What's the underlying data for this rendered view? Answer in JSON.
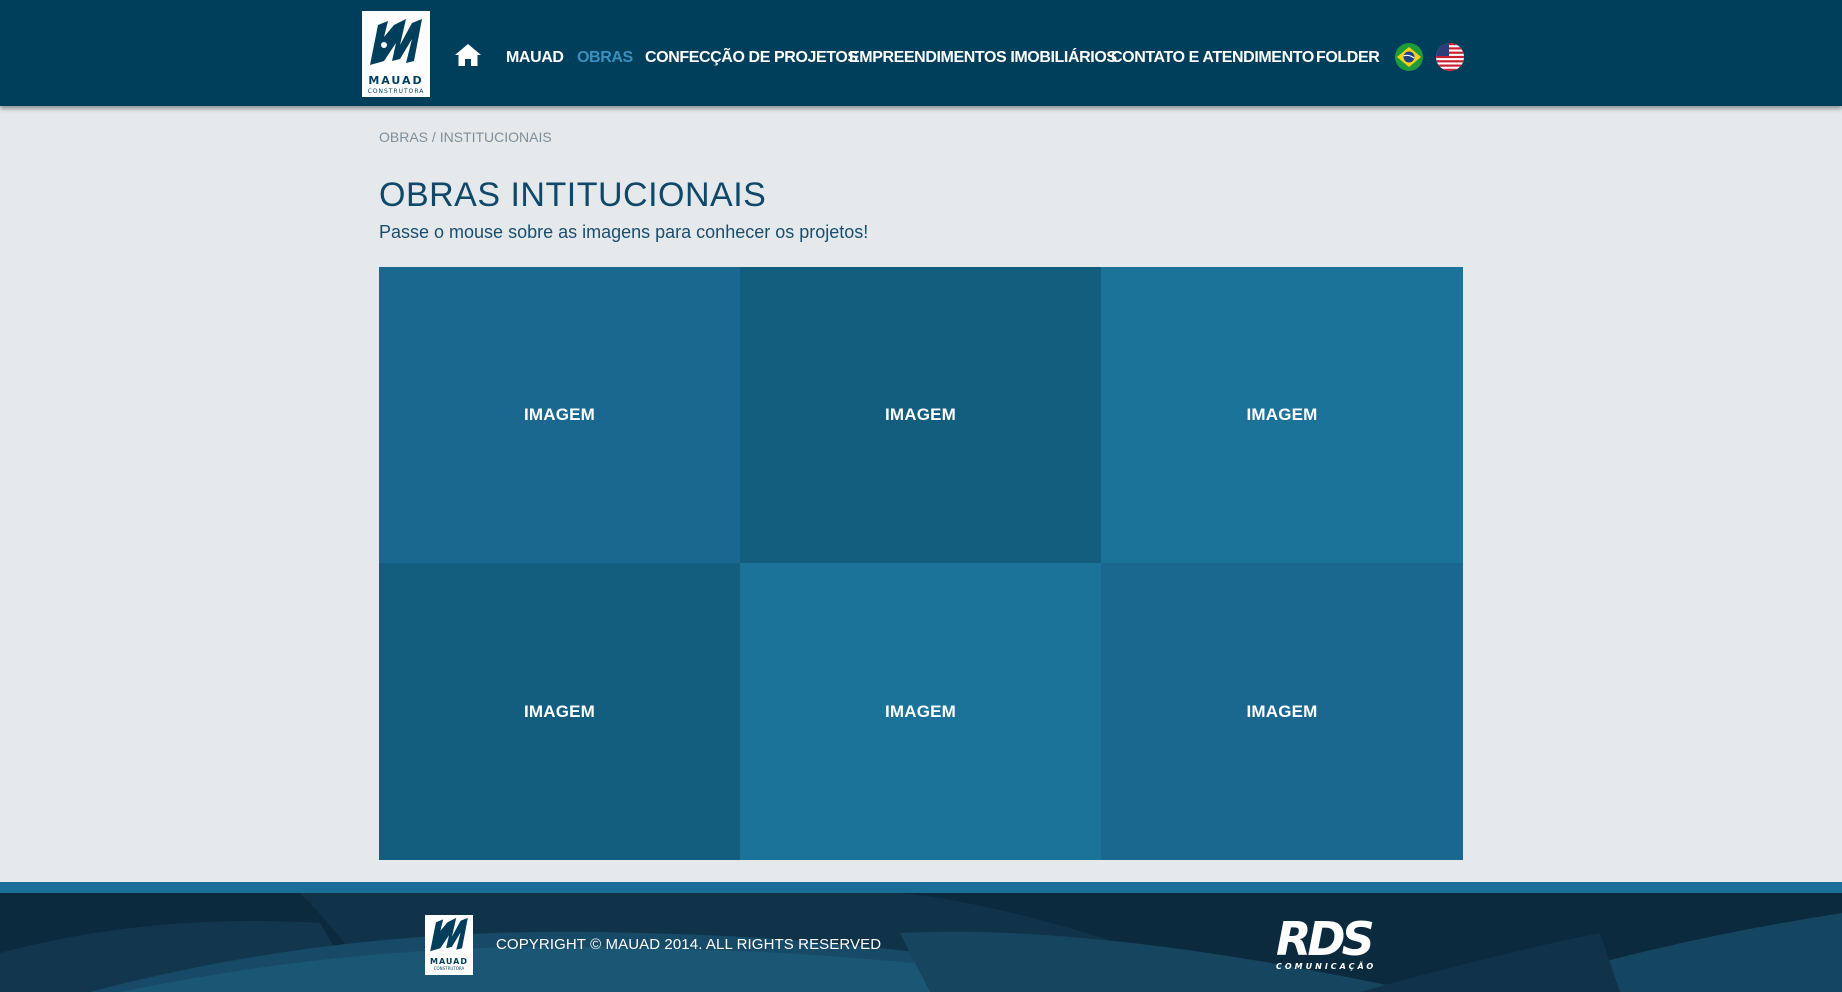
{
  "header": {
    "logo": {
      "word": "MAUAD",
      "sub": "CONSTRUTORA"
    },
    "nav": [
      {
        "label": "MAUAD",
        "active": false
      },
      {
        "label": "OBRAS",
        "active": true
      },
      {
        "label": "CONFECÇÃO DE PROJETOS",
        "active": false
      },
      {
        "label": "EMPREENDIMENTOS IMOBILIÁRIOS",
        "active": false
      },
      {
        "label": "CONTATO E ATENDIMENTO",
        "active": false
      },
      {
        "label": "FOLDER",
        "active": false
      }
    ],
    "icons": {
      "home": "home-icon",
      "flags": [
        "brazil-flag-icon",
        "usa-flag-icon"
      ]
    }
  },
  "breadcrumb": {
    "parent": "OBRAS",
    "separator": " / ",
    "current": "INSTITUCIONAIS"
  },
  "page": {
    "title": "OBRAS INTITUCIONAIS",
    "subtitle": "Passe o mouse sobre as imagens para conhecer os projetos!"
  },
  "tiles": [
    {
      "label": "IMAGEM",
      "color": "#1a6890"
    },
    {
      "label": "IMAGEM",
      "color": "#135d7e"
    },
    {
      "label": "IMAGEM",
      "color": "#1c739a"
    },
    {
      "label": "IMAGEM",
      "color": "#135d7e"
    },
    {
      "label": "IMAGEM",
      "color": "#1c739a"
    },
    {
      "label": "IMAGEM",
      "color": "#1a6890"
    }
  ],
  "footer": {
    "logo": {
      "word": "MAUAD",
      "sub": "CONSTRUTORA"
    },
    "copyright": "COPYRIGHT © MAUAD 2014. ALL RIGHTS RESERVED",
    "agency": {
      "word": "RDS",
      "sub": "COMUNICAÇÃO"
    }
  },
  "colors": {
    "header_bg": "#003f5c",
    "nav_active": "#3a8fbf",
    "page_bg": "#e5e9ec",
    "title": "#0f4868",
    "footer_stripe": "#1b6e98",
    "footer_bg": "#0c2a3d"
  }
}
